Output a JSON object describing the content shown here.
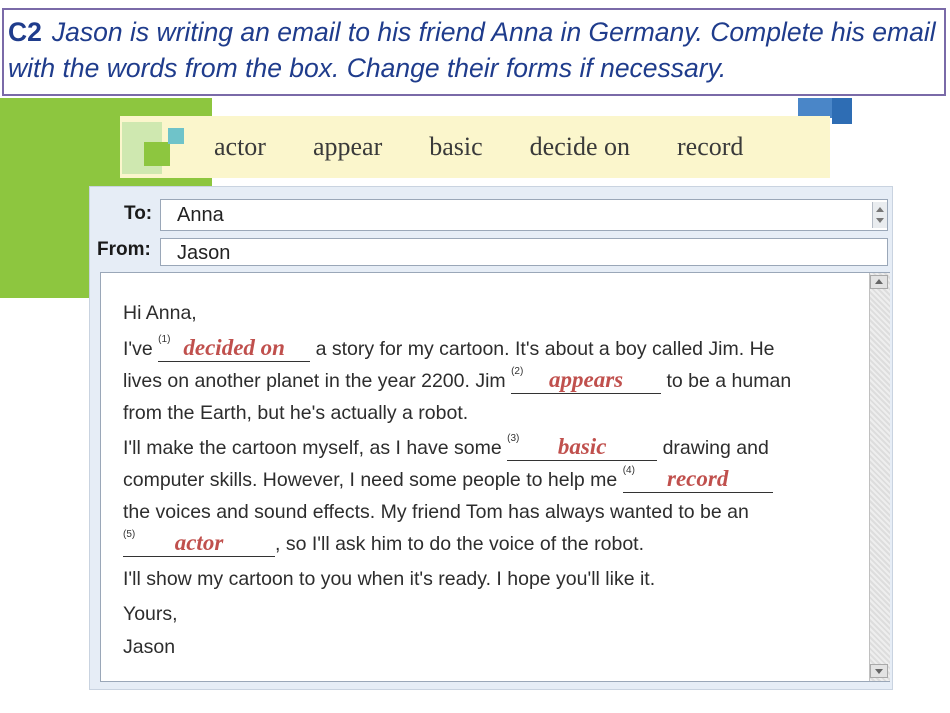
{
  "title": {
    "number": "C2",
    "instruction": "Jason is writing an email to his friend Anna in Germany. Complete his email with the words from the box. Change their forms if necessary."
  },
  "word_box": [
    "actor",
    "appear",
    "basic",
    "decide on",
    "record"
  ],
  "email": {
    "to_label": "To:",
    "to_value": "Anna",
    "from_label": "From:",
    "from_value": "Jason",
    "greeting": "Hi Anna,",
    "line2_a": "I've",
    "blank1_num": "(1)",
    "blank1_answer": "decided on",
    "line2_b": "a story for my cartoon. It's about a boy called Jim. He",
    "line3_a": "lives on another planet in the year 2200. Jim",
    "blank2_num": "(2)",
    "blank2_answer": "appears",
    "line3_b": "to be a human",
    "line4": "from the Earth, but he's actually a robot.",
    "line5_a": "I'll make the cartoon myself, as I have some",
    "blank3_num": "(3)",
    "blank3_answer": "basic",
    "line5_b": "drawing and",
    "line6_a": "computer skills. However, I need some people to help me",
    "blank4_num": "(4)",
    "blank4_answer": "record",
    "line7": "the voices and sound effects. My friend Tom has always wanted to be an",
    "blank5_num": "(5)",
    "blank5_answer": "actor",
    "line8_b": ", so I'll ask him to do the voice of the robot.",
    "line9": "I'll show my cartoon to you when it's ready. I hope you'll like it.",
    "closing": "Yours,",
    "signature": "Jason"
  },
  "colors": {
    "title_text": "#1f3c8c",
    "answer_text": "#c0504d",
    "accent_green": "#8dc63f",
    "word_box_bg": "#fbf6cc"
  }
}
